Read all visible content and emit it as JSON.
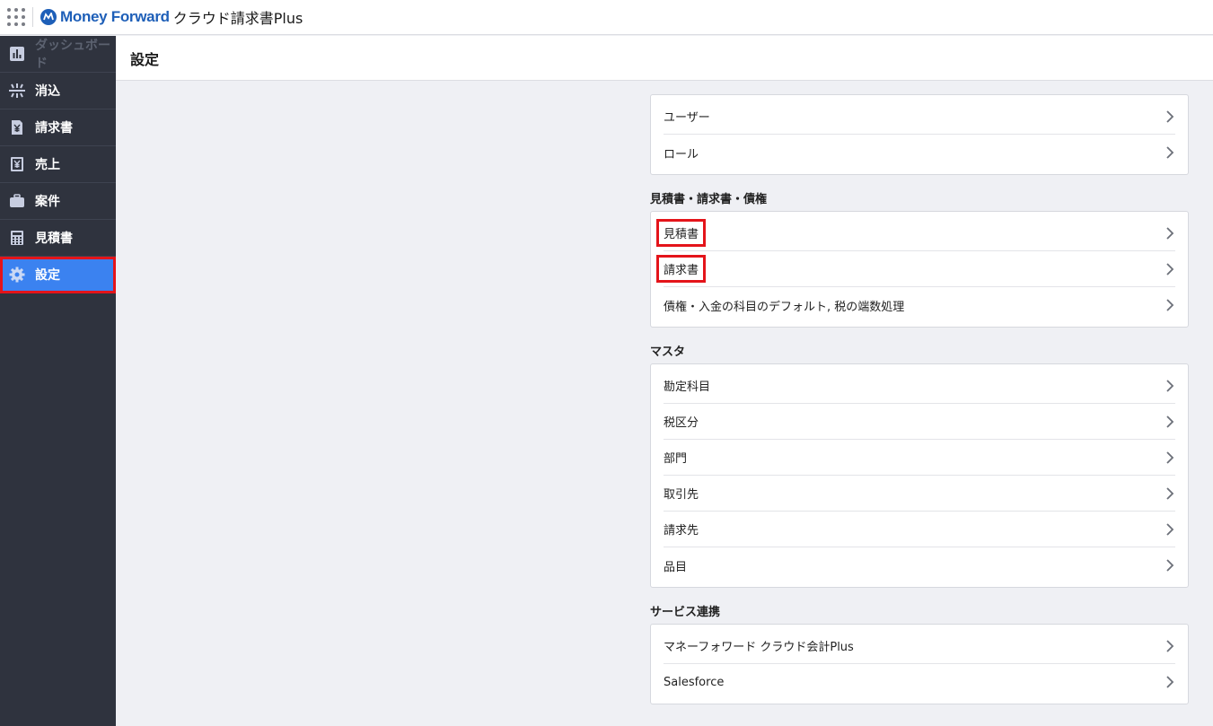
{
  "header": {
    "brand": "Money Forward",
    "product": "クラウド請求書Plus"
  },
  "sidebar": {
    "items": [
      {
        "label": "ダッシュボード",
        "icon": "bar-chart-icon",
        "state": "faded"
      },
      {
        "label": "消込",
        "icon": "reconcile-icon",
        "state": "normal"
      },
      {
        "label": "請求書",
        "icon": "invoice-yen-icon",
        "state": "normal"
      },
      {
        "label": "売上",
        "icon": "sales-yen-icon",
        "state": "normal"
      },
      {
        "label": "案件",
        "icon": "briefcase-icon",
        "state": "normal"
      },
      {
        "label": "見積書",
        "icon": "calculator-icon",
        "state": "normal"
      },
      {
        "label": "設定",
        "icon": "gear-icon",
        "state": "active"
      }
    ]
  },
  "page": {
    "title": "設定"
  },
  "settings": {
    "general": [
      {
        "label": "ユーザー"
      },
      {
        "label": "ロール"
      }
    ],
    "docs_section_title": "見積書・請求書・債権",
    "docs": [
      {
        "label": "見積書",
        "highlighted": true
      },
      {
        "label": "請求書",
        "highlighted": true
      },
      {
        "label": "債権・入金の科目のデフォルト, 税の端数処理",
        "highlighted": false
      }
    ],
    "master_section_title": "マスタ",
    "master": [
      {
        "label": "勘定科目"
      },
      {
        "label": "税区分"
      },
      {
        "label": "部門"
      },
      {
        "label": "取引先"
      },
      {
        "label": "請求先"
      },
      {
        "label": "品目"
      }
    ],
    "services_section_title": "サービス連携",
    "services": [
      {
        "label": "マネーフォワード クラウド会計Plus"
      },
      {
        "label": "Salesforce"
      }
    ]
  },
  "colors": {
    "sidebar_bg": "#2f333e",
    "active_bg": "#3b82f0",
    "highlight_outline": "#e4141a",
    "brand_blue": "#1e5fb8"
  }
}
